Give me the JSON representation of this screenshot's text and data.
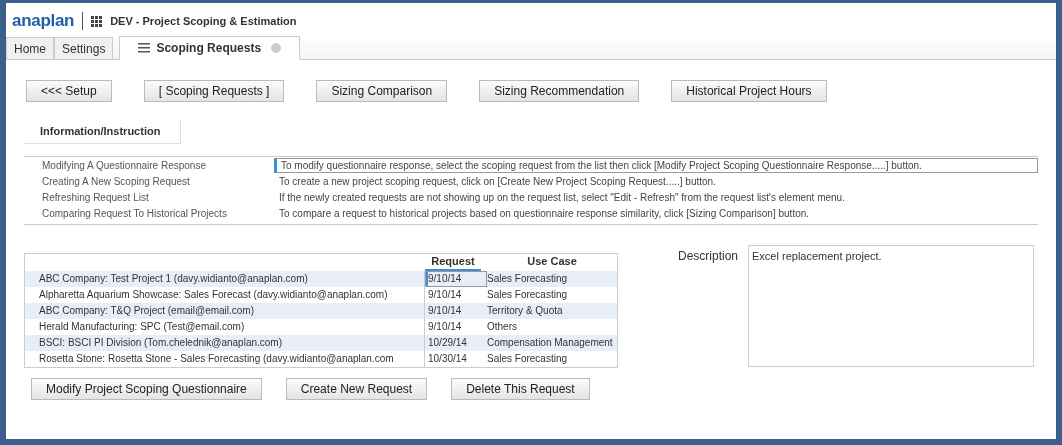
{
  "header": {
    "logo": "anaplan",
    "title": "DEV - Project Scoping & Estimation"
  },
  "tabs": [
    {
      "label": "Home",
      "selected": false,
      "closable": false,
      "menu": false
    },
    {
      "label": "Settings",
      "selected": false,
      "closable": false,
      "menu": false
    },
    {
      "label": "Scoping Requests",
      "selected": true,
      "closable": true,
      "menu": true
    }
  ],
  "nav_buttons": [
    "<<< Setup",
    "[ Scoping Requests ]",
    "Sizing Comparison",
    "Sizing Recommendation",
    "Historical Project Hours"
  ],
  "section_title": "Information/Instruction",
  "instructions": [
    {
      "topic": "Modifying A Questionnaire Response",
      "text": "To modify questionnaire response, select the scoping request from the list then click [Modify Project Scoping Questionnaire Response.....] button.",
      "selected": true
    },
    {
      "topic": "Creating A New Scoping Request",
      "text": "To create a new project scoping request, click on [Create New Project Scoping Request.....] button.",
      "selected": false
    },
    {
      "topic": "Refreshing Request List",
      "text": "If the newly created requests are not showing up on the request list, select \"Edit - Refresh\" from the request list's element menu.",
      "selected": false
    },
    {
      "topic": "Comparing Request To Historical Projects",
      "text": "To compare a request to historical projects based on questionnaire response similarity, click [Sizing Comparison] button.",
      "selected": false
    }
  ],
  "requests": {
    "columns": [
      "Request",
      "Use Case"
    ],
    "rows": [
      {
        "name": "ABC Company: Test Project 1 (davy.widianto@anaplan.com)",
        "request": "9/10/14",
        "use_case": "Sales Forecasting",
        "selected": true
      },
      {
        "name": "Alpharetta Aquarium Showcase: Sales Forecast (davy.widianto@anaplan.com)",
        "request": "9/10/14",
        "use_case": "Sales Forecasting",
        "selected": false
      },
      {
        "name": "ABC Company: T&Q Project (email@email.com)",
        "request": "9/10/14",
        "use_case": "Territory & Quota",
        "selected": false
      },
      {
        "name": "Herald Manufacturing: SPC (Test@email.com)",
        "request": "9/10/14",
        "use_case": "Others",
        "selected": false
      },
      {
        "name": "BSCI: BSCI PI Division (Tom.chelednik@anaplan.com)",
        "request": "10/29/14",
        "use_case": "Compensation Management",
        "selected": false
      },
      {
        "name": "Rosetta Stone: Rosetta Stone - Sales Forecasting (davy.widianto@anaplan.com",
        "request": "10/30/14",
        "use_case": "Sales Forecasting",
        "selected": false
      }
    ]
  },
  "description": {
    "label": "Description",
    "value": "Excel replacement project."
  },
  "action_buttons": [
    "Modify Project Scoping Questionnaire",
    "Create New Request",
    "Delete This Request"
  ]
}
